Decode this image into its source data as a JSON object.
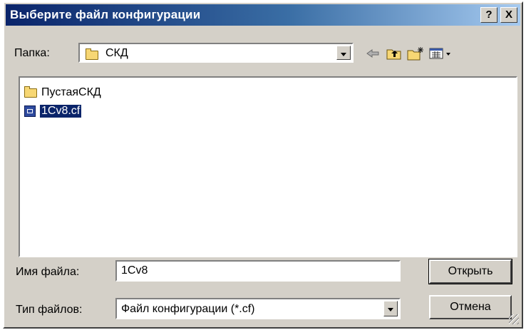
{
  "dialog": {
    "title": "Выберите файл конфигурации",
    "help_label": "?",
    "close_label": "X"
  },
  "folder_bar": {
    "label": "Папка:",
    "current_folder": "СКД"
  },
  "toolbar": {
    "icons": [
      "back-arrow-icon",
      "up-folder-icon",
      "new-folder-icon",
      "view-menu-icon"
    ]
  },
  "file_list": {
    "items": [
      {
        "name": "ПустаяСКД",
        "icon": "folder-icon",
        "selected": false
      },
      {
        "name": "1Cv8.cf",
        "icon": "config-file-icon",
        "selected": true
      }
    ]
  },
  "filename": {
    "label": "Имя файла:",
    "value": "1Cv8"
  },
  "filetype": {
    "label": "Тип файлов:",
    "value": "Файл конфигурации (*.cf)"
  },
  "buttons": {
    "open_label": "Открыть",
    "cancel_label": "Отмена"
  },
  "colors": {
    "titlebar_start": "#0a246a",
    "titlebar_end": "#a6caf0",
    "dialog_face": "#d4d0c8",
    "selection": "#0a246a"
  }
}
